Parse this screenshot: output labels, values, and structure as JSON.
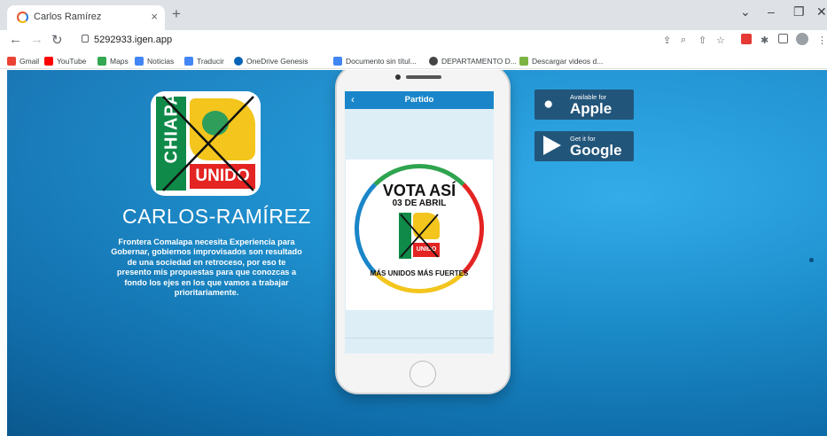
{
  "browser": {
    "tab_title": "Carlos Ramírez",
    "tab_close": "×",
    "new_tab": "+",
    "window_controls": [
      "⌄",
      "–",
      "❐",
      "✕"
    ],
    "url": "5292933.igen.app"
  },
  "bookmarks": [
    {
      "label": "Gmail",
      "icon": "gmail-icon",
      "color": "#ea4335"
    },
    {
      "label": "YouTube",
      "icon": "youtube-icon",
      "color": "#ff0000"
    },
    {
      "label": "Maps",
      "icon": "maps-icon",
      "color": "#34a853"
    },
    {
      "label": "Noticias",
      "icon": "news-icon",
      "color": "#4285f4"
    },
    {
      "label": "Traducir",
      "icon": "translate-icon",
      "color": "#4285f4"
    },
    {
      "label": "OneDrive Genesis",
      "icon": "onedrive-icon",
      "color": "#0364b8"
    },
    {
      "label": "Documento sin títul...",
      "icon": "docs-icon",
      "color": "#4285f4"
    },
    {
      "label": "DEPARTAMENTO D...",
      "icon": "globe-icon",
      "color": "#444444"
    },
    {
      "label": "Descargar videos d...",
      "icon": "download-icon",
      "color": "#7cb342"
    }
  ],
  "hero": {
    "logo_left": "CHIAPAS",
    "logo_bottom": "UNIDO",
    "name": "CARLOS-RAMÍREZ",
    "description": "Frontera Comalapa necesita Experiencia para Gobernar, gobiernos improvisados son resultado de una sociedad en retroceso, por eso te presento mis propuestas para que conozcas a fondo los ejes en los que vamos a trabajar prioritariamente."
  },
  "phone": {
    "app_title": "Partido",
    "back": "‹",
    "badge_title": "VOTA ASÍ",
    "badge_date": "03 DE ABRIL",
    "badge_mini_label": "UNIDO",
    "badge_slogan": "MÁS UNIDOS MÁS FUERTES"
  },
  "stores": {
    "apple_small": "Available for",
    "apple_big": "Apple",
    "google_small": "Get it for",
    "google_big": "Google"
  },
  "colors": {
    "page_blue": "#1a94d6",
    "store_bg": "#22557a",
    "app_bar": "#1a86c9",
    "party_green": "#0f8a49",
    "party_red": "#e32422",
    "party_yellow": "#f3c51d"
  }
}
